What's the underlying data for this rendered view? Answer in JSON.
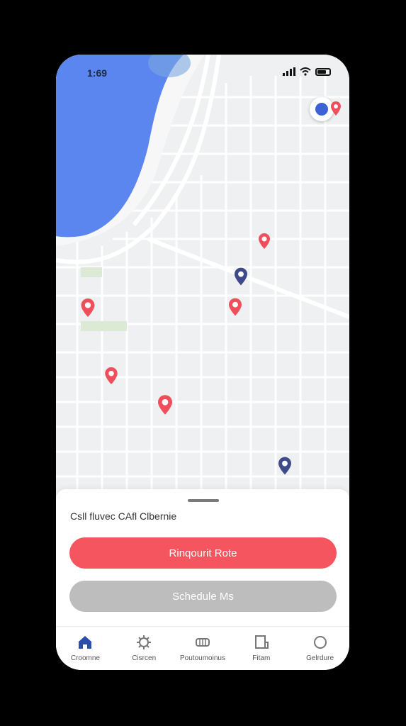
{
  "status_bar": {
    "time": "1:69"
  },
  "map": {
    "water_color": "#5b86ef",
    "marker_red": "#ef4e5a",
    "marker_navy": "#3e4a8a",
    "markers": [
      {
        "name": "poi-marker-red",
        "color": "red"
      },
      {
        "name": "poi-marker-navy",
        "color": "navy"
      }
    ]
  },
  "sheet": {
    "title": "Csll fluvec CAfl Clbernie",
    "primary_button": "Rinqourit Rote",
    "secondary_button": "Schedule Ms"
  },
  "tabs": [
    {
      "label": "Croomne",
      "icon": "home-icon",
      "active": true
    },
    {
      "label": "Cisrcen",
      "icon": "settings-icon",
      "active": false
    },
    {
      "label": "Poutoumoinus",
      "icon": "vehicle-icon",
      "active": false
    },
    {
      "label": "Fitam",
      "icon": "document-icon",
      "active": false
    },
    {
      "label": "Gelrdure",
      "icon": "circle-icon",
      "active": false
    }
  ],
  "colors": {
    "accent": "#f5555e",
    "tab_active": "#2b4fa8",
    "tab_inactive": "#777777"
  }
}
